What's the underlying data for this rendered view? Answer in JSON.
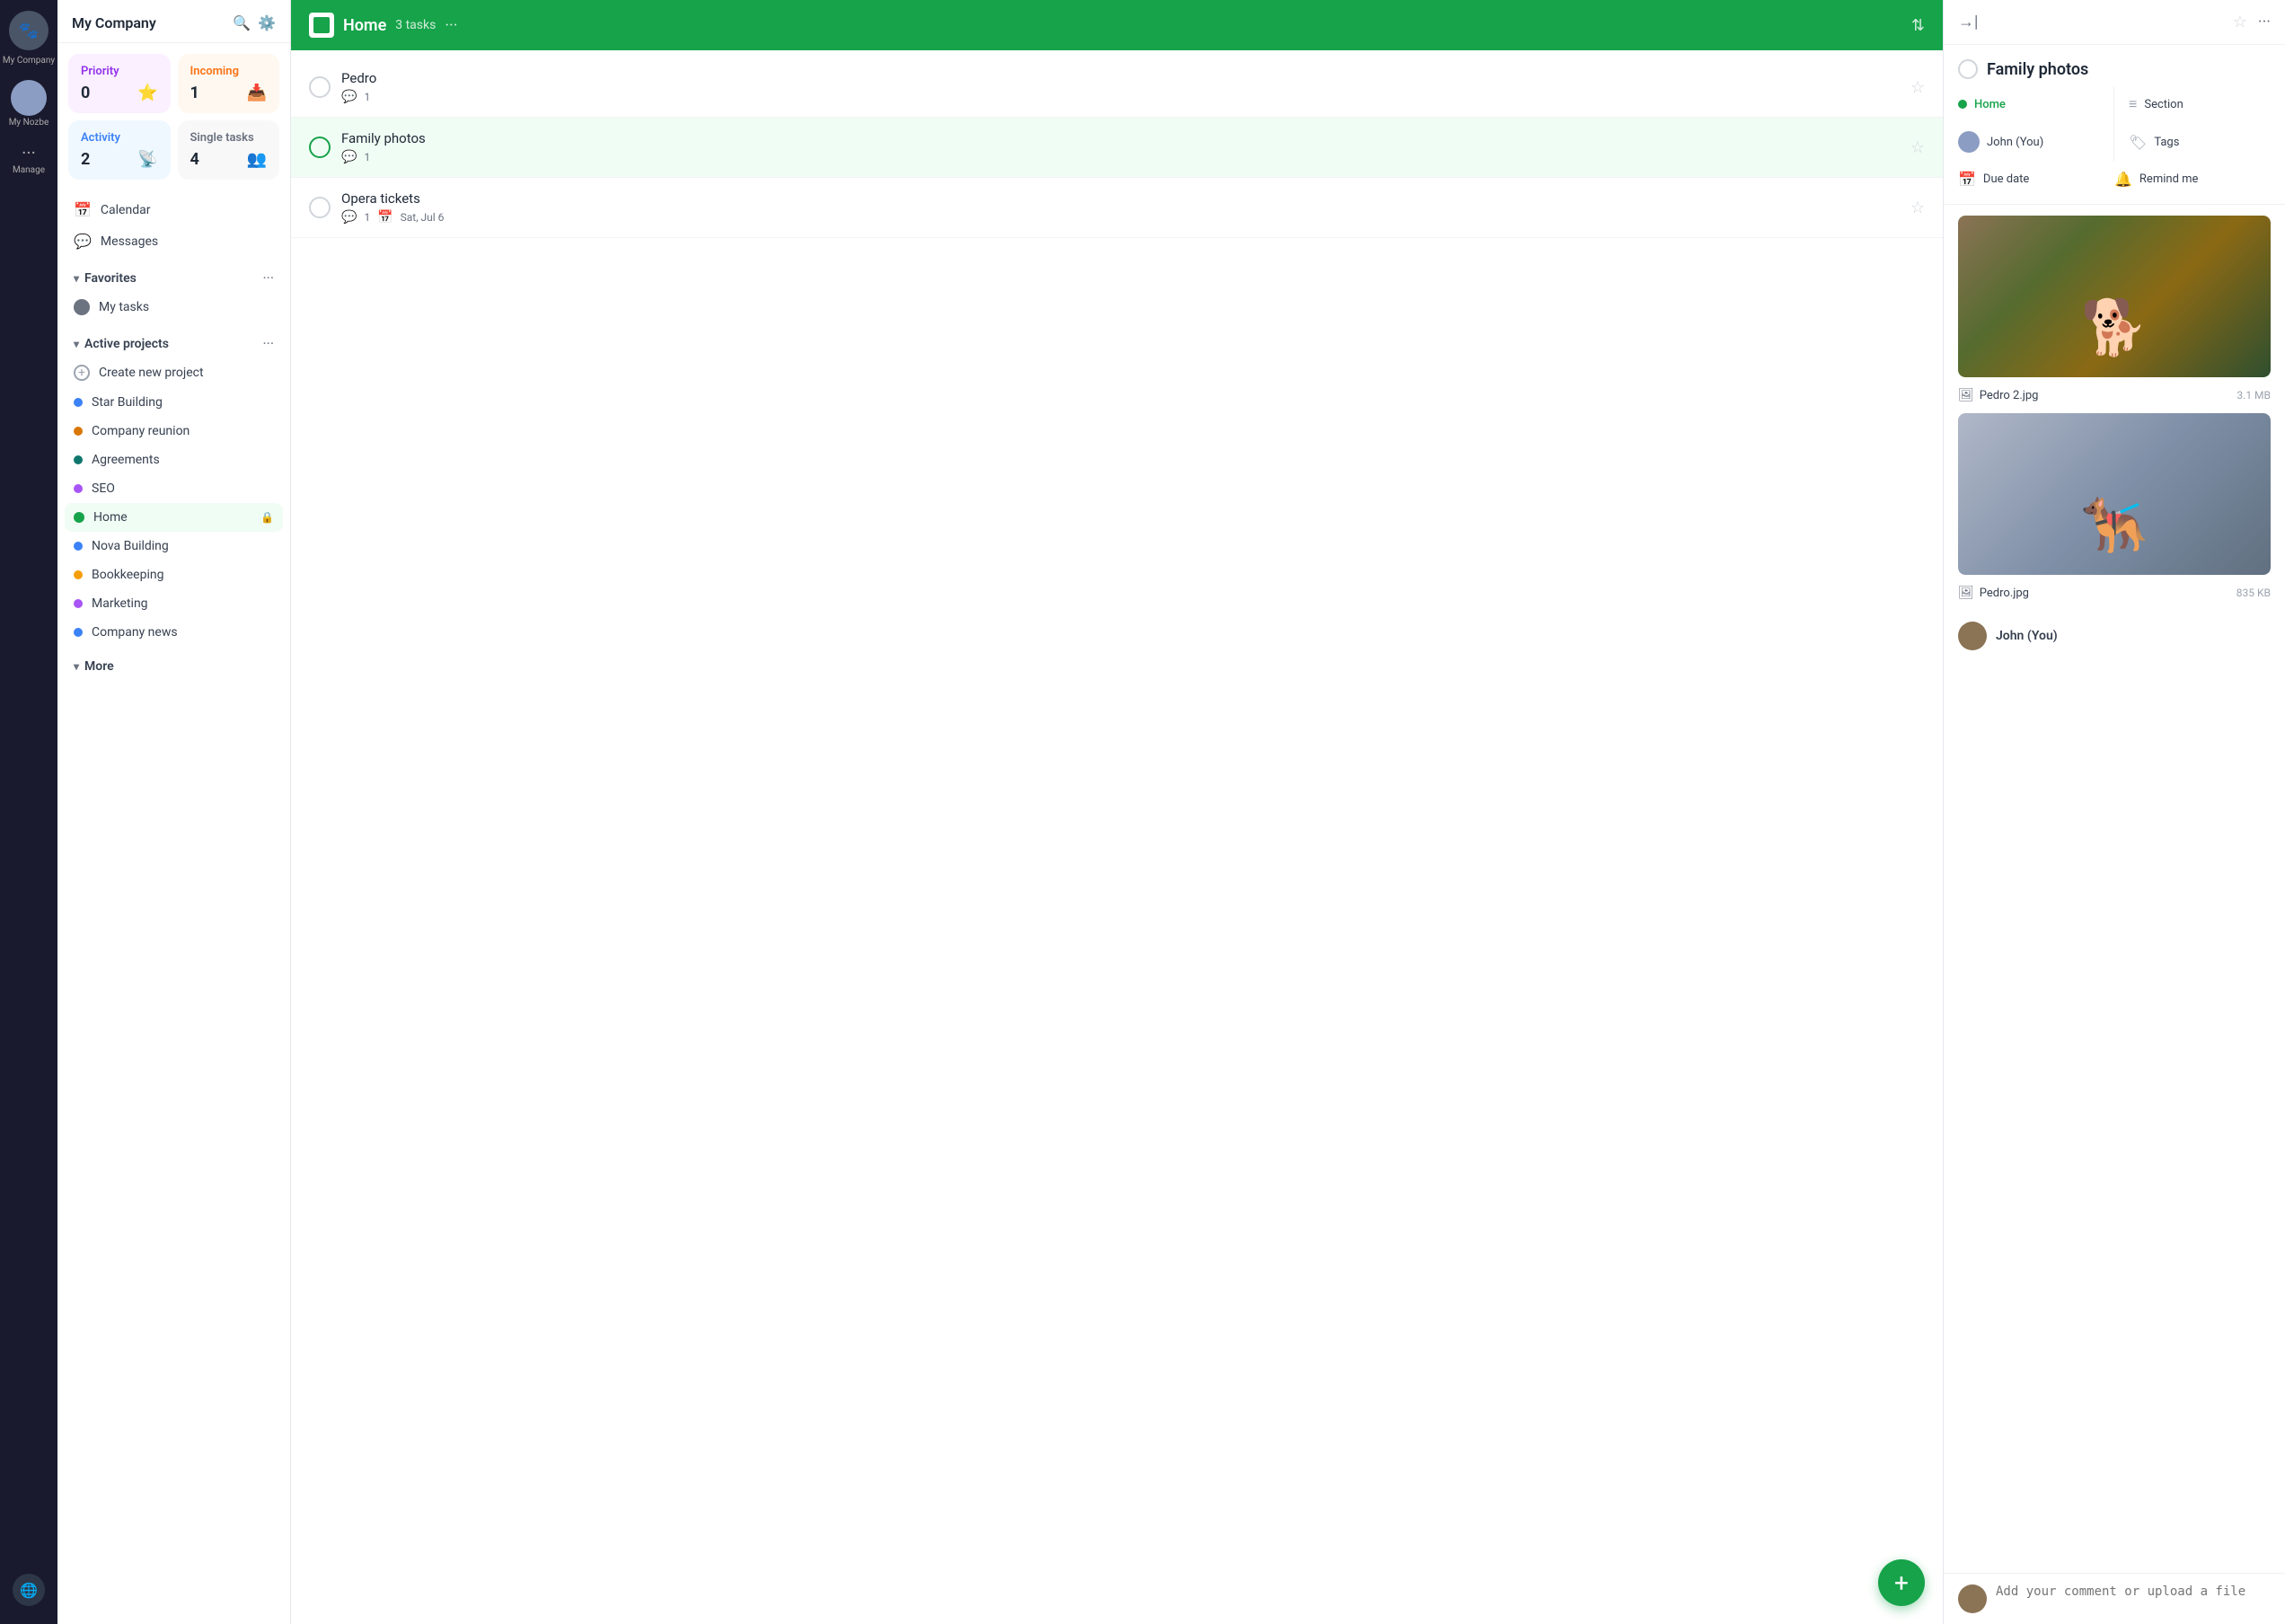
{
  "app": {
    "company_name": "My Company",
    "logo_emoji": "🐾"
  },
  "icon_bar": {
    "app_label": "My Company",
    "avatar_label": "My Nozbe",
    "manage_label": "Manage"
  },
  "sidebar": {
    "title": "My Company",
    "stat_cards": [
      {
        "id": "priority",
        "label": "Priority",
        "count": "0",
        "icon": "⭐",
        "type": "priority"
      },
      {
        "id": "incoming",
        "label": "Incoming",
        "count": "1",
        "icon": "📥",
        "type": "incoming"
      },
      {
        "id": "activity",
        "label": "Activity",
        "count": "2",
        "icon": "📡",
        "type": "activity"
      },
      {
        "id": "single",
        "label": "Single tasks",
        "count": "4",
        "icon": "👥",
        "type": "single"
      }
    ],
    "nav_items": [
      {
        "id": "calendar",
        "label": "Calendar",
        "icon": "📅"
      },
      {
        "id": "messages",
        "label": "Messages",
        "icon": "💬"
      }
    ],
    "favorites": {
      "label": "Favorites",
      "items": [
        {
          "id": "my-tasks",
          "label": "My tasks",
          "avatar": true
        }
      ]
    },
    "active_projects": {
      "label": "Active projects",
      "items": [
        {
          "id": "create-new",
          "label": "Create new project",
          "dot_color": null,
          "is_plus": true
        },
        {
          "id": "star-building",
          "label": "Star Building",
          "dot_color": "#3b82f6"
        },
        {
          "id": "company-reunion",
          "label": "Company reunion",
          "dot_color": "#d97706"
        },
        {
          "id": "agreements",
          "label": "Agreements",
          "dot_color": "#0f766e"
        },
        {
          "id": "seo",
          "label": "SEO",
          "dot_color": "#a855f7"
        },
        {
          "id": "home",
          "label": "Home",
          "dot_color": "#16a34a",
          "active": true,
          "locked": true
        },
        {
          "id": "nova-building",
          "label": "Nova Building",
          "dot_color": "#3b82f6"
        },
        {
          "id": "bookkeeping",
          "label": "Bookkeeping",
          "dot_color": "#f59e0b"
        },
        {
          "id": "marketing",
          "label": "Marketing",
          "dot_color": "#a855f7"
        },
        {
          "id": "company-news",
          "label": "Company news",
          "dot_color": "#3b82f6"
        }
      ]
    },
    "more": {
      "label": "More"
    }
  },
  "main": {
    "header": {
      "title": "Home",
      "task_count": "3 tasks"
    },
    "tasks": [
      {
        "id": "pedro",
        "title": "Pedro",
        "comment_count": "1",
        "star": false,
        "active": false
      },
      {
        "id": "family-photos",
        "title": "Family photos",
        "comment_count": "1",
        "star": false,
        "active": true
      },
      {
        "id": "opera-tickets",
        "title": "Opera tickets",
        "comment_count": "1",
        "due_date": "Sat, Jul 6",
        "star": false,
        "active": false
      }
    ],
    "fab_label": "+"
  },
  "right_panel": {
    "task_title": "Family photos",
    "meta": {
      "project_label": "Home",
      "section_label": "Section",
      "assignee_label": "John (You)",
      "tags_label": "Tags",
      "due_date_label": "Due date",
      "remind_me_label": "Remind me"
    },
    "attachments": [
      {
        "id": "pedro2",
        "filename": "Pedro 2.jpg",
        "size": "3.1 MB"
      },
      {
        "id": "pedro",
        "filename": "Pedro.jpg",
        "size": "835 KB"
      }
    ],
    "comment": {
      "commenter": "John (You)",
      "placeholder": "Add your comment or upload a file"
    }
  }
}
